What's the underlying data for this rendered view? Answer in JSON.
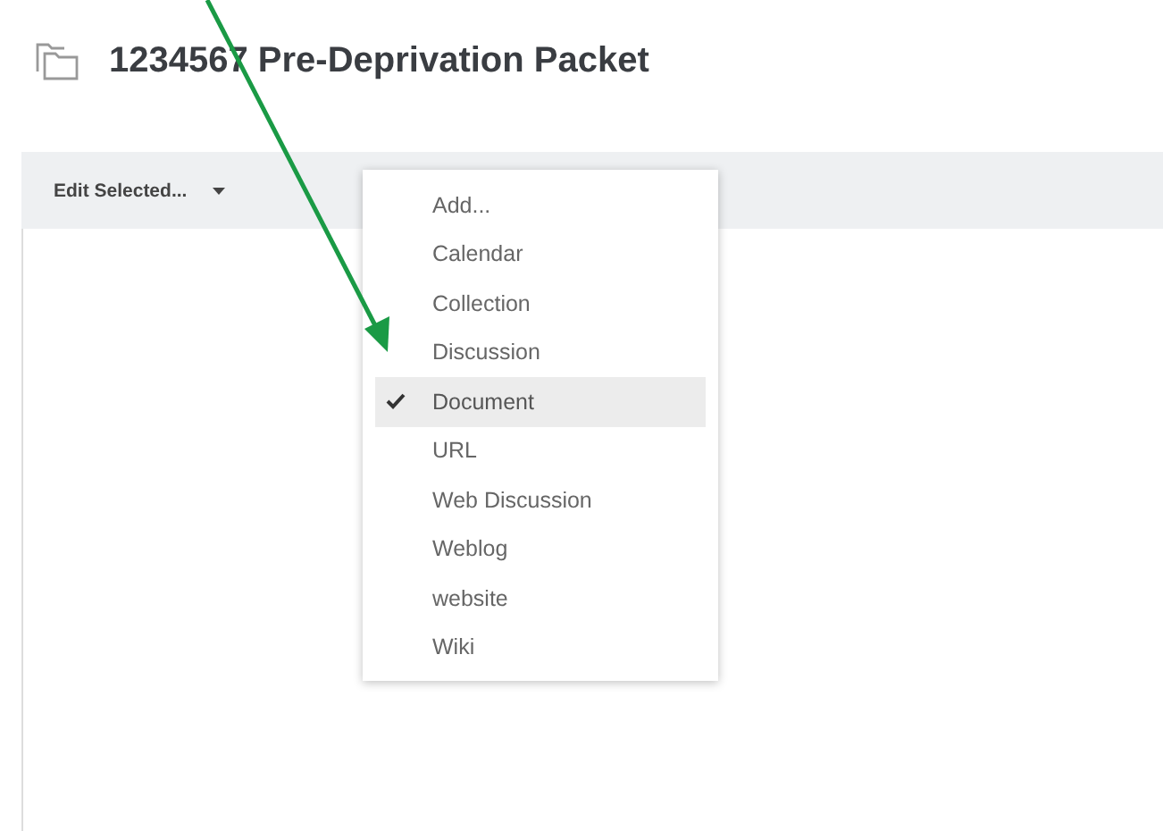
{
  "page": {
    "title": "1234567 Pre-Deprivation Packet"
  },
  "toolbar": {
    "edit_selected": "Edit Selected..."
  },
  "add_menu": {
    "items": [
      {
        "label": "Add...",
        "selected": false
      },
      {
        "label": "Calendar",
        "selected": false
      },
      {
        "label": "Collection",
        "selected": false
      },
      {
        "label": "Discussion",
        "selected": false
      },
      {
        "label": "Document",
        "selected": true
      },
      {
        "label": "URL",
        "selected": false
      },
      {
        "label": "Web Discussion",
        "selected": false
      },
      {
        "label": "Weblog",
        "selected": false
      },
      {
        "label": "website",
        "selected": false
      },
      {
        "label": "Wiki",
        "selected": false
      }
    ]
  }
}
